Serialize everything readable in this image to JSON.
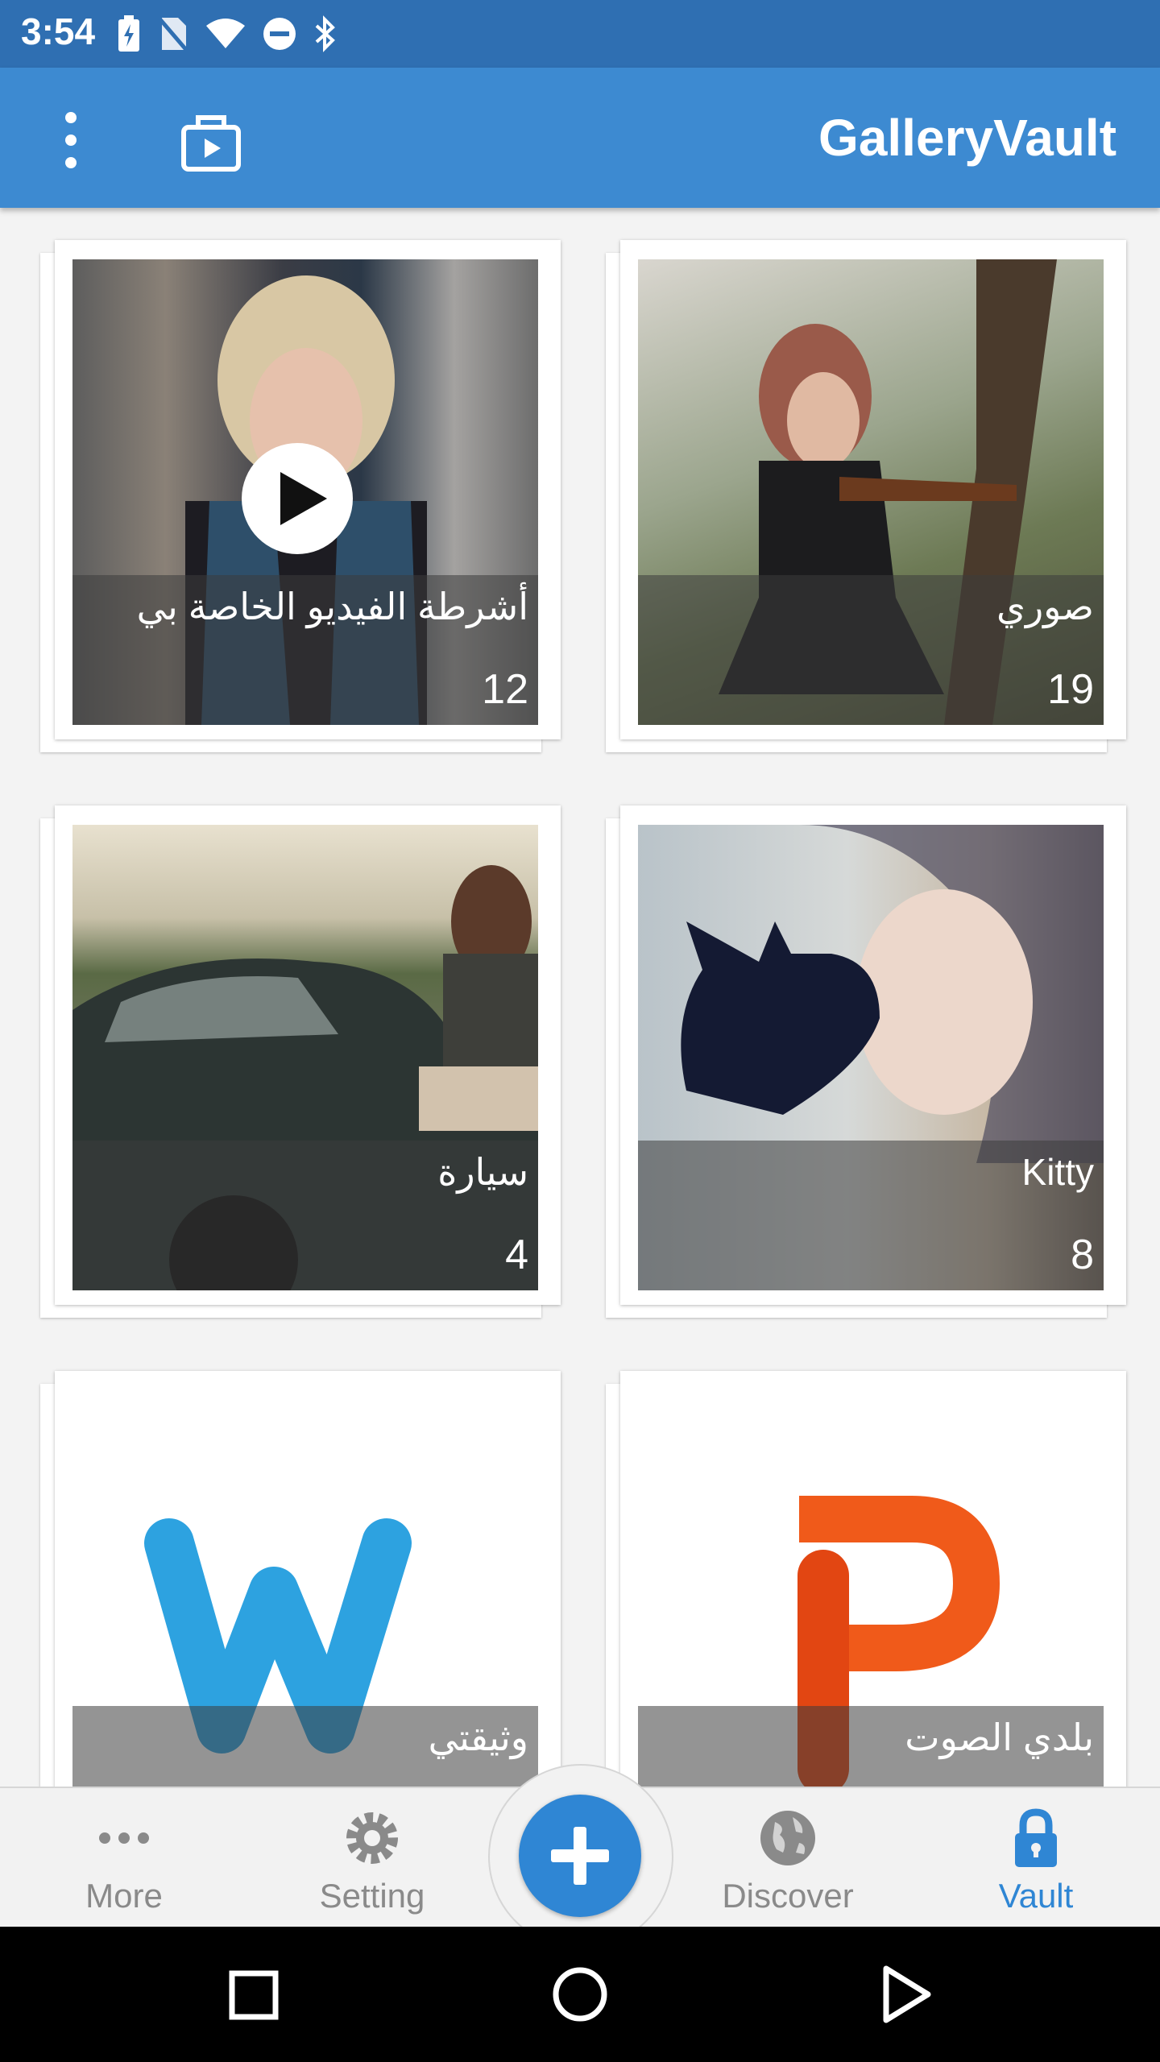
{
  "status_bar": {
    "time": "3:54"
  },
  "app_bar": {
    "title": "GalleryVault"
  },
  "albums": [
    {
      "name": "أشرطة الفيديو الخاصة بي",
      "count": "12",
      "is_video": true
    },
    {
      "name": "صوري",
      "count": "19"
    },
    {
      "name": "سيارة",
      "count": "4"
    },
    {
      "name": "Kitty",
      "count": "8"
    },
    {
      "name": "وثيقتي",
      "count": "",
      "icon": "word-w-logo"
    },
    {
      "name": "بلدي الصوت",
      "count": "",
      "icon": "orange-p-logo"
    }
  ],
  "bottom_nav": {
    "items": [
      {
        "label": "More",
        "icon": "more-dots-icon"
      },
      {
        "label": "Setting",
        "icon": "gear-icon"
      },
      {
        "label": "Discover",
        "icon": "globe-icon"
      },
      {
        "label": "Vault",
        "icon": "lock-icon",
        "active": true
      }
    ],
    "fab_icon": "plus-icon"
  },
  "colors": {
    "app_bar": "#3d8ad1",
    "status_bar": "#2f6fb2",
    "accent": "#2f86d4"
  }
}
